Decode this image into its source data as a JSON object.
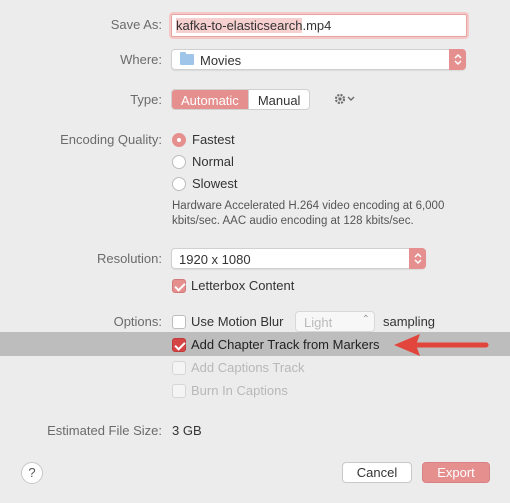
{
  "save_as": {
    "label": "Save As:",
    "filename_selected": "kafka-to-elasticsearch",
    "filename_ext": ".mp4"
  },
  "where": {
    "label": "Where:",
    "value": "Movies",
    "icon": "folder-icon"
  },
  "type": {
    "label": "Type:",
    "options": [
      "Automatic",
      "Manual"
    ],
    "selected": "Automatic",
    "gear_icon": "gear-icon"
  },
  "encoding": {
    "label": "Encoding Quality:",
    "options": [
      "Fastest",
      "Normal",
      "Slowest"
    ],
    "selected": "Fastest",
    "description_line1": "Hardware Accelerated H.264 video encoding at 6,000",
    "description_line2": "kbits/sec.  AAC audio encoding at 128 kbits/sec."
  },
  "resolution": {
    "label": "Resolution:",
    "value": "1920 x 1080",
    "letterbox_label": "Letterbox Content",
    "letterbox_checked": true
  },
  "options": {
    "label": "Options:",
    "motion_blur_label": "Use Motion Blur",
    "motion_blur_checked": false,
    "blur_value": "Light",
    "sampling_label": "sampling",
    "chapter_track_label": "Add Chapter Track from Markers",
    "chapter_track_checked": true,
    "captions_track_label": "Add Captions Track",
    "burn_captions_label": "Burn In Captions"
  },
  "file_size": {
    "label": "Estimated File Size:",
    "value": "3 GB"
  },
  "buttons": {
    "help": "?",
    "cancel": "Cancel",
    "export": "Export"
  },
  "colors": {
    "accent": "#e58f8f",
    "arrow": "#e2453c",
    "highlight": "#bdbdbd"
  }
}
